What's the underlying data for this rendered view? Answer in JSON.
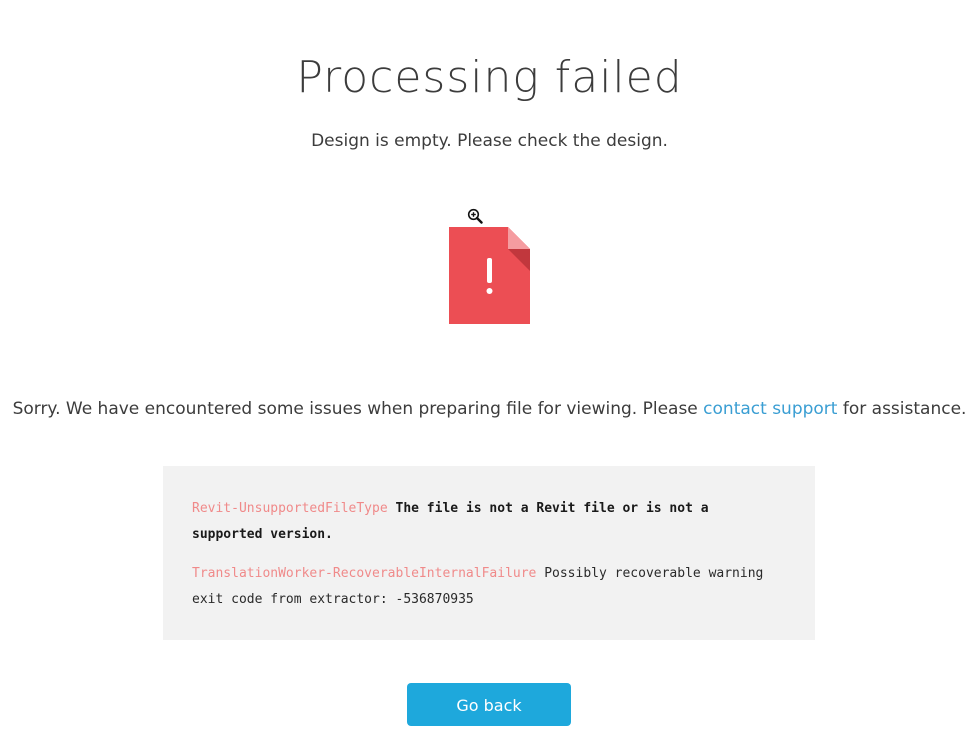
{
  "title": "Processing failed",
  "subtitle": "Design is empty. Please check the design.",
  "icons": {
    "zoom": "zoom-in-icon",
    "file": "file-error-icon",
    "file_color": "#ec4e54",
    "file_fold_color": "#c1373d",
    "file_fold_light": "#f59ca0"
  },
  "message": {
    "prefix": "Sorry. We have encountered some issues when preparing file for viewing. Please ",
    "link_label": "contact support",
    "suffix": " for assistance.",
    "link_color": "#3a9ed3"
  },
  "errors": [
    {
      "code": "Revit-UnsupportedFileType",
      "text": "The file is not a Revit file or is not a supported version.",
      "bold": true
    },
    {
      "code": "TranslationWorker-RecoverableInternalFailure",
      "text": "Possibly recoverable warning exit code from extractor: -536870935",
      "bold": false
    }
  ],
  "colors": {
    "error_code": "#f08a8a",
    "button_bg": "#1ea8dc",
    "box_bg": "#f2f2f2"
  },
  "button": {
    "go_back_label": "Go back"
  }
}
